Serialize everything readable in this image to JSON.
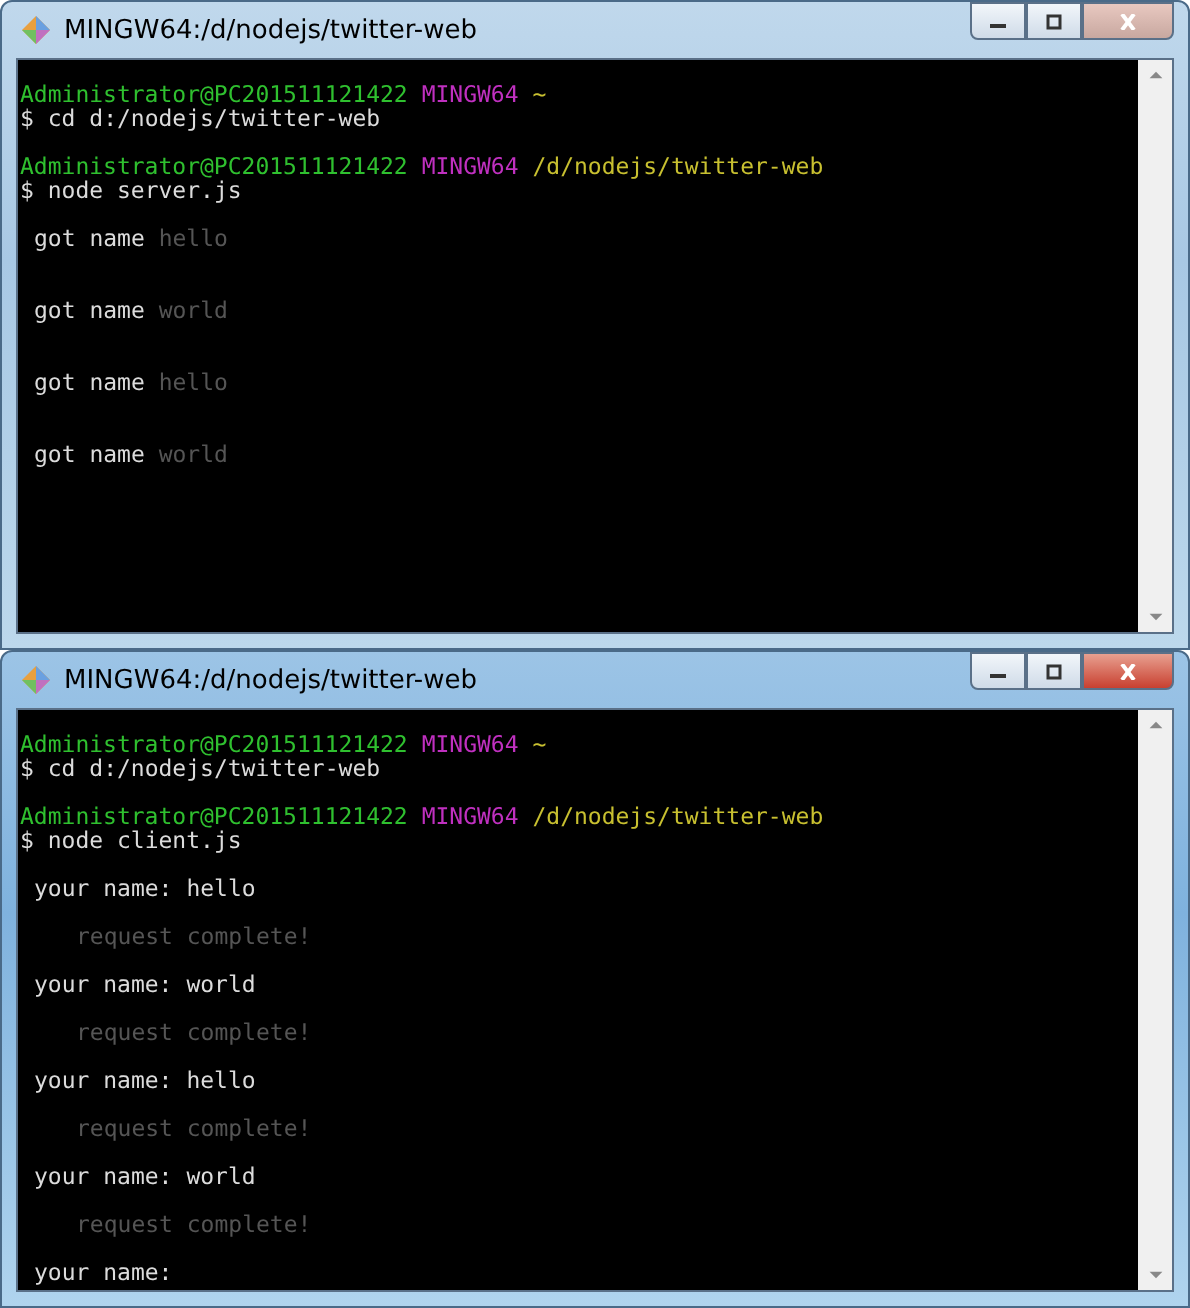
{
  "windows": [
    {
      "title": "MINGW64:/d/nodejs/twitter-web",
      "active": false,
      "prompts": [
        {
          "user": "Administrator@PC201511121422",
          "host": "MINGW64",
          "path": "~",
          "symbol": "$",
          "command": "cd d:/nodejs/twitter-web"
        },
        {
          "user": "Administrator@PC201511121422",
          "host": "MINGW64",
          "path": "/d/nodejs/twitter-web",
          "symbol": "$",
          "command": "node server.js"
        }
      ],
      "output": [
        {
          "kind": "log",
          "label": "got name",
          "value": "hello"
        },
        {
          "kind": "log",
          "label": "got name",
          "value": "world"
        },
        {
          "kind": "log",
          "label": "got name",
          "value": "hello"
        },
        {
          "kind": "log",
          "label": "got name",
          "value": "world"
        }
      ]
    },
    {
      "title": "MINGW64:/d/nodejs/twitter-web",
      "active": true,
      "prompts": [
        {
          "user": "Administrator@PC201511121422",
          "host": "MINGW64",
          "path": "~",
          "symbol": "$",
          "command": "cd d:/nodejs/twitter-web"
        },
        {
          "user": "Administrator@PC201511121422",
          "host": "MINGW64",
          "path": "/d/nodejs/twitter-web",
          "symbol": "$",
          "command": "node client.js"
        }
      ],
      "output": [
        {
          "kind": "input",
          "label": "your name:",
          "value": "hello"
        },
        {
          "kind": "status",
          "text": "request complete!"
        },
        {
          "kind": "input",
          "label": "your name:",
          "value": "world"
        },
        {
          "kind": "status",
          "text": "request complete!"
        },
        {
          "kind": "input",
          "label": "your name:",
          "value": "hello"
        },
        {
          "kind": "status",
          "text": "request complete!"
        },
        {
          "kind": "input",
          "label": "your name:",
          "value": "world"
        },
        {
          "kind": "status",
          "text": "request complete!"
        },
        {
          "kind": "input",
          "label": "your name:"
        }
      ]
    }
  ]
}
